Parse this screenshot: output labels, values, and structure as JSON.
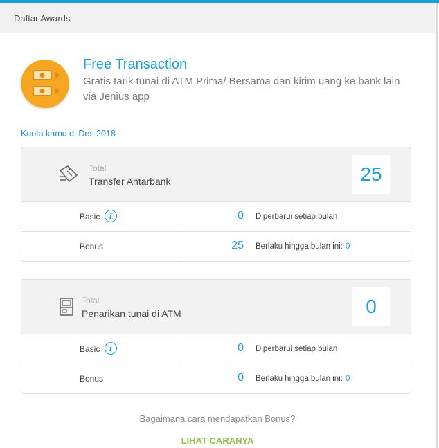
{
  "header": {
    "title": "Daftar Awards"
  },
  "award": {
    "icon": "money-transfer-icon",
    "title": "Free Transaction",
    "description": "Gratis tarik tunai di ATM Prima/ Bersama dan kirim uang ke bank lain via Jenius app"
  },
  "quota_label": "Kuota kamu di Des 2018",
  "cards": [
    {
      "icon": "transfer-ticket-icon",
      "label": "Total",
      "name": "Transfer Antarbank",
      "total": "25",
      "rows": [
        {
          "label": "Basic",
          "value": "0",
          "note": "Diperbarui setiap bulan",
          "note_value": ""
        },
        {
          "label": "Bonus",
          "value": "25",
          "note": "Berlaku hingga bulan ini:",
          "note_value": "0"
        }
      ]
    },
    {
      "icon": "atm-icon",
      "label": "Total",
      "name": "Penarikan tunai di ATM",
      "total": "0",
      "rows": [
        {
          "label": "Basic",
          "value": "0",
          "note": "Diperbarui setiap bulan",
          "note_value": ""
        },
        {
          "label": "Bonus",
          "value": "0",
          "note": "Berlaku hingga bulan ini:",
          "note_value": "0"
        }
      ]
    }
  ],
  "bonus_question": "Bagaimana cara mendapatkan Bonus?",
  "bonus_link": "LIHAT CARANYA",
  "info_icon_glyph": "i",
  "colors": {
    "accent": "#1ea0dc",
    "link": "#8bc34a",
    "award": "#f5a623"
  }
}
